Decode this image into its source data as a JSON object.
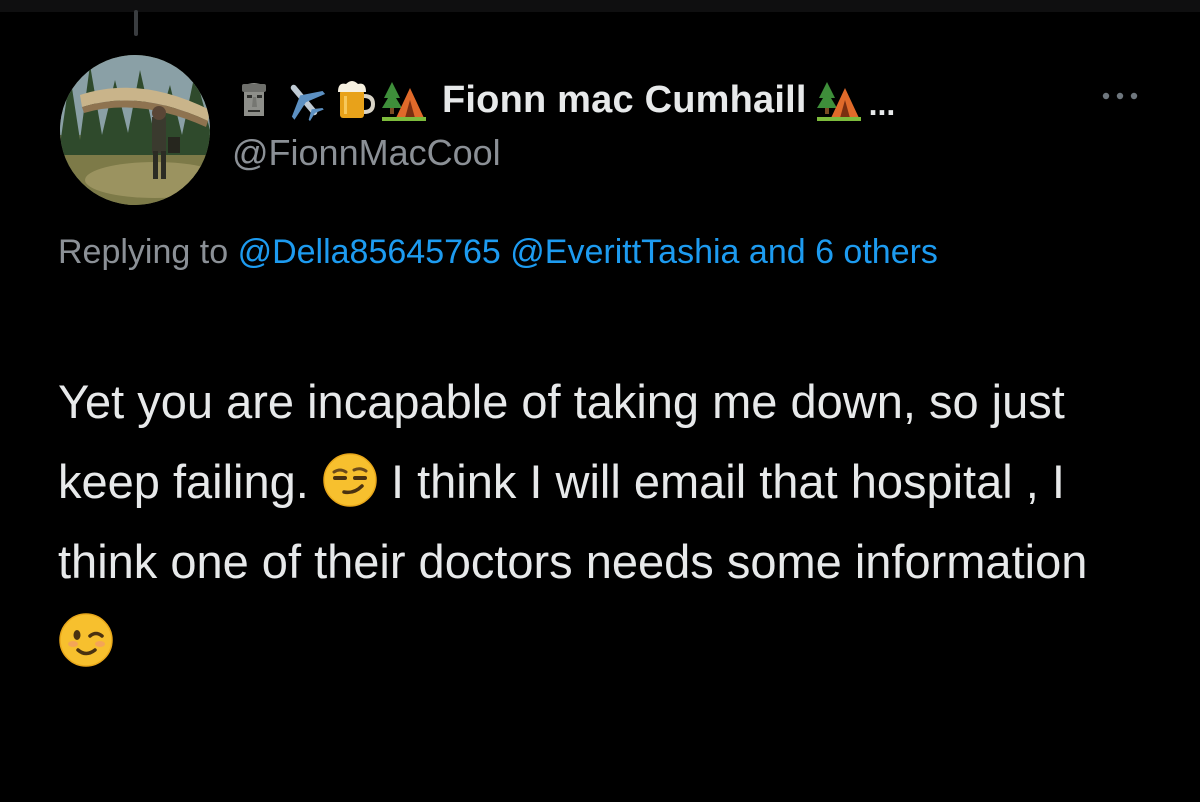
{
  "tweet": {
    "author": {
      "name_prefix_icons": [
        "moai-icon",
        "airplane-icon",
        "beer-mug-icon",
        "camping-icon"
      ],
      "display_name": "Fionn mac Cumhaill",
      "name_suffix_icon": "camping-icon",
      "name_truncation": "...",
      "handle": "@FionnMacCool"
    },
    "more_icon": "more-horizontal-icon",
    "reply_context": {
      "prefix": "Replying to",
      "mention_1": "@Della85645765",
      "mention_2": "@EverittTashia",
      "suffix": "and 6 others"
    },
    "text": {
      "part_1": "Yet you are incapable of taking me down, so just keep failing.",
      "emoji_1": "smirking-face-icon",
      "part_2": "I think I will email that hospital , I think one of their doctors needs some information",
      "emoji_2": "winking-face-icon"
    },
    "colors": {
      "background": "#000000",
      "primary_text": "#e7e9ea",
      "secondary_text": "#8b9096",
      "link": "#1d9bf0"
    }
  }
}
